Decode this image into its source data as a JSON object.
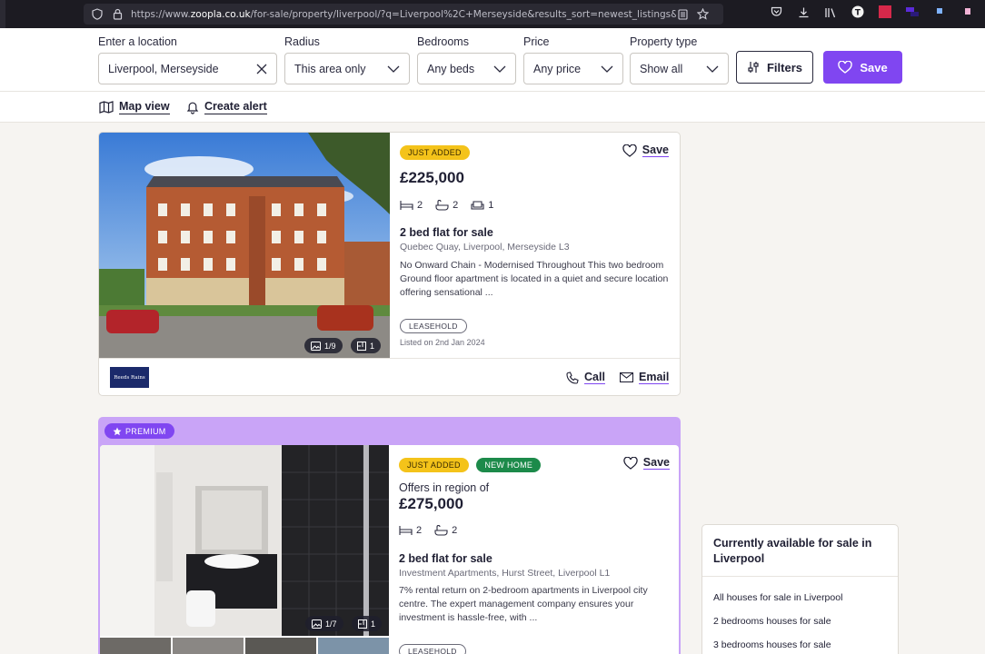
{
  "browser": {
    "url_prefix": "https://www.",
    "url_domain": "zoopla.co.uk",
    "url_rest": "/for-sale/property/liverpool/?q=Liverpool%2C+Merseyside&results_sort=newest_listings&search_source=ho"
  },
  "search": {
    "location_label": "Enter a location",
    "location_value": "Liverpool, Merseyside",
    "radius_label": "Radius",
    "radius_value": "This area only",
    "bedrooms_label": "Bedrooms",
    "bedrooms_value": "Any beds",
    "price_label": "Price",
    "price_value": "Any price",
    "type_label": "Property type",
    "type_value": "Show all",
    "filters_label": "Filters",
    "save_label": "Save"
  },
  "subnav": {
    "map_view": "Map view",
    "create_alert": "Create alert"
  },
  "listings": [
    {
      "badge": "JUST ADDED",
      "price": "£225,000",
      "beds": "2",
      "baths": "2",
      "receptions": "1",
      "title": "2 bed flat for sale",
      "address": "Quebec Quay, Liverpool, Merseyside L3",
      "description": "No Onward Chain - Modernised Throughout This two bedroom Ground floor apartment is located in a quiet and secure location offering sensational ...",
      "tenure": "LEASEHOLD",
      "listed": "Listed on 2nd Jan 2024",
      "photos": "1/9",
      "floorplans": "1",
      "save_label": "Save",
      "agent": "Reeds Rains",
      "call_label": "Call",
      "email_label": "Email"
    },
    {
      "premium_label": "PREMIUM",
      "badge": "JUST ADDED",
      "badge2": "NEW HOME",
      "price_prefix": "Offers in region of",
      "price": "£275,000",
      "beds": "2",
      "baths": "2",
      "title": "2 bed flat for sale",
      "address": "Investment Apartments, Hurst Street, Liverpool L1",
      "description": "7% rental return on 2-bedroom apartments in Liverpool city centre. The expert management company ensures your investment is hassle-free, with ...",
      "tenure": "LEASEHOLD",
      "photos": "1/7",
      "floorplans": "1",
      "save_label": "Save"
    }
  ],
  "sidebar": {
    "title": "Currently available for sale in Liverpool",
    "links": [
      "All houses for sale in Liverpool",
      "2 bedrooms houses for sale",
      "3 bedrooms houses for sale"
    ]
  },
  "colors": {
    "brand_purple": "#8046f1",
    "premium_border": "#c9a4f7",
    "badge_yellow": "#f4c31a",
    "badge_green": "#1c8a4a"
  }
}
